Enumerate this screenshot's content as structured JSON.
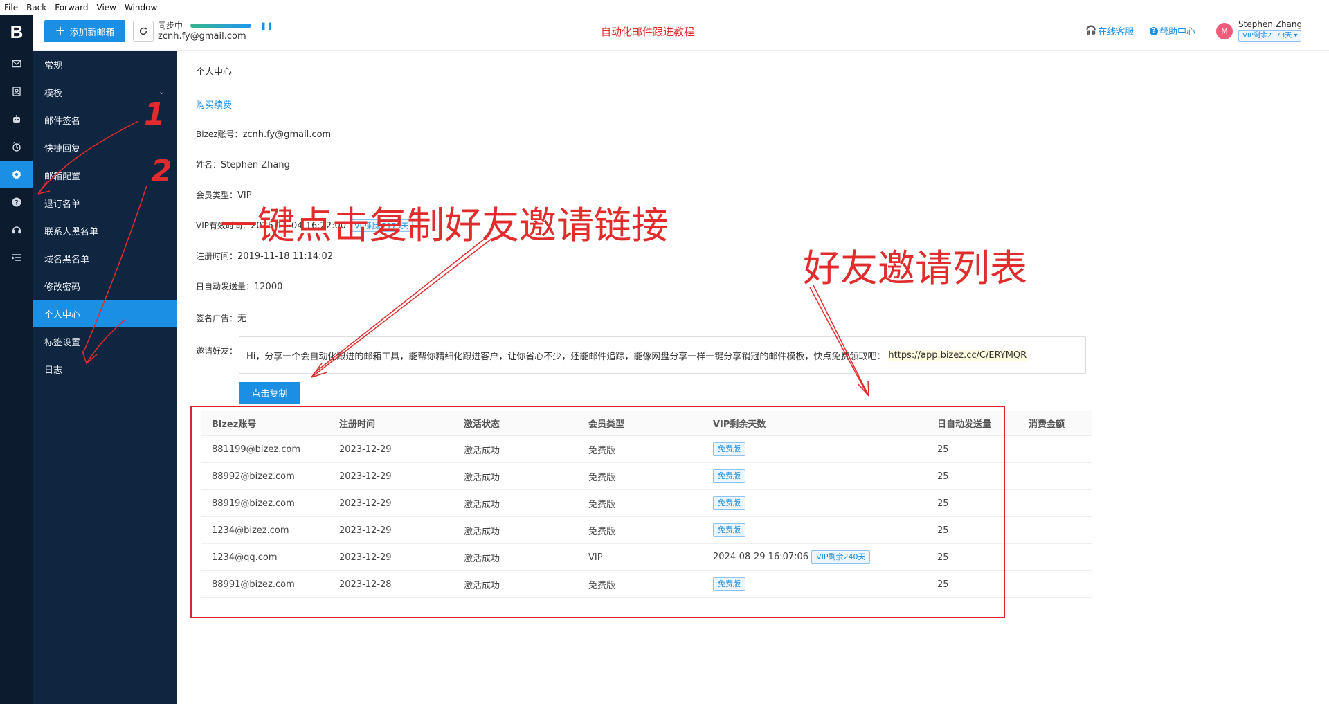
{
  "menubar": [
    "File",
    "Back",
    "Forward",
    "View",
    "Window"
  ],
  "header": {
    "add_mailbox": "添加新邮箱",
    "sync_status": "同步中",
    "account_email": "zcnh.fy@gmail.com",
    "center_title": "自动化邮件跟进教程",
    "online_support": "在线客服",
    "help_center": "帮助中心",
    "avatar_letter": "M",
    "user_name": "Stephen Zhang",
    "vip_badge": "VIP剩余2173天 ▾"
  },
  "rail": {
    "logo": "B",
    "icons": [
      "mail-icon",
      "contacts-icon",
      "robot-icon",
      "alarm-icon",
      "gear-icon",
      "help-icon",
      "support-icon",
      "list-icon"
    ],
    "active_index": 4
  },
  "sidebar": {
    "items": [
      {
        "label": "常规"
      },
      {
        "label": "模板"
      },
      {
        "label": "邮件签名"
      },
      {
        "label": "快捷回复"
      },
      {
        "label": "邮箱配置"
      },
      {
        "label": "退订名单"
      },
      {
        "label": "联系人黑名单"
      },
      {
        "label": "域名黑名单"
      },
      {
        "label": "修改密码"
      },
      {
        "label": "个人中心"
      },
      {
        "label": "标签设置"
      },
      {
        "label": "日志"
      }
    ],
    "active_label": "个人中心"
  },
  "main": {
    "page_title": "个人中心",
    "renew_link": "购买续费",
    "fields": {
      "account": {
        "key": "Bizez账号：",
        "value": "zcnh.fy@gmail.com"
      },
      "name": {
        "key": "姓名：",
        "value": "Stephen Zhang"
      },
      "member_type": {
        "key": "会员类型：",
        "value": "VIP"
      },
      "vip_expiry": {
        "key": "VIP有效时间：",
        "value": "2025-11-04 16:22:00",
        "tag": "VIP剩余2173天"
      },
      "register_time": {
        "key": "注册时间：",
        "value": "2019-11-18 11:14:02"
      },
      "daily_quota": {
        "key": "日自动发送量：",
        "value": "12000"
      },
      "signature_ad": {
        "key": "签名广告：",
        "value": "无"
      }
    },
    "invite": {
      "label": "邀请好友：",
      "text": "Hi，分享一个会自动化跟进的邮箱工具，能帮你精细化跟进客户，让你省心不少，还能邮件追踪，能像网盘分享一样一键分享销冠的邮件模板，快点免费领取吧：",
      "url": "https://app.bizez.cc/C/ERYMQR",
      "copy_button": "点击复制"
    },
    "table": {
      "columns": [
        "Bizez账号",
        "注册时间",
        "激活状态",
        "会员类型",
        "VIP剩余天数",
        "日自动发送量",
        "消费金额"
      ],
      "rows": [
        {
          "account": "881199@bizez.com",
          "date": "2023-12-29",
          "status": "激活成功",
          "type": "免费版",
          "vip": "",
          "vip_tag": "免费版",
          "quota": "25",
          "spent": ""
        },
        {
          "account": "88992@bizez.com",
          "date": "2023-12-29",
          "status": "激活成功",
          "type": "免费版",
          "vip": "",
          "vip_tag": "免费版",
          "quota": "25",
          "spent": ""
        },
        {
          "account": "88919@bizez.com",
          "date": "2023-12-29",
          "status": "激活成功",
          "type": "免费版",
          "vip": "",
          "vip_tag": "免费版",
          "quota": "25",
          "spent": ""
        },
        {
          "account": "1234@bizez.com",
          "date": "2023-12-29",
          "status": "激活成功",
          "type": "免费版",
          "vip": "",
          "vip_tag": "免费版",
          "quota": "25",
          "spent": ""
        },
        {
          "account": "1234@qq.com",
          "date": "2023-12-29",
          "status": "激活成功",
          "type": "VIP",
          "vip": "2024-08-29 16:07:06",
          "vip_tag": "VIP剩余240天",
          "quota": "25",
          "spent": ""
        },
        {
          "account": "88991@bizez.com",
          "date": "2023-12-28",
          "status": "激活成功",
          "type": "免费版",
          "vip": "",
          "vip_tag": "免费版",
          "quota": "25",
          "spent": ""
        }
      ]
    }
  },
  "annotations": {
    "num1": "1",
    "num2": "2",
    "copy_hint": "一键点击复制好友邀请链接",
    "list_hint": "好友邀请列表"
  },
  "colors": {
    "accent": "#1a8fe3",
    "rail": "#0c1b2e",
    "sidebar": "#0f2540",
    "annotation": "#e02c2c"
  }
}
